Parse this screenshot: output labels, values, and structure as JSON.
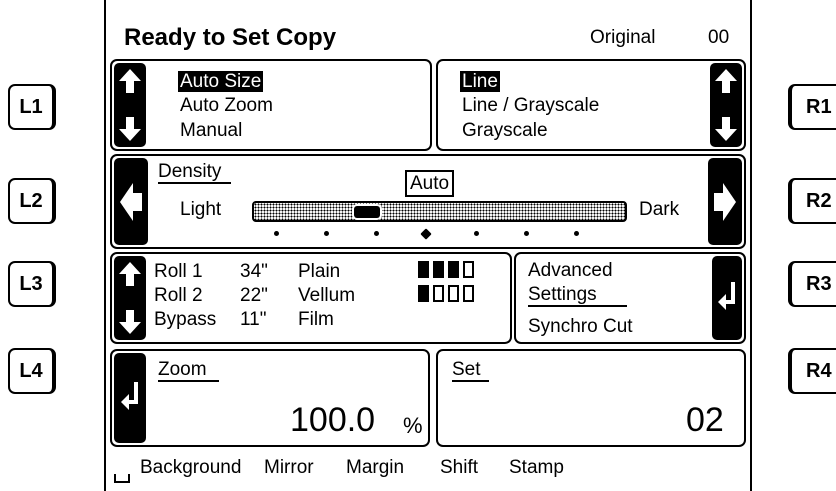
{
  "header": {
    "title": "Ready to Set Copy",
    "original_label": "Original",
    "original_count": "00"
  },
  "side_keys": {
    "left": [
      "L1",
      "L2",
      "L3",
      "L4"
    ],
    "right": [
      "R1",
      "R2",
      "R3",
      "R4"
    ]
  },
  "size_panel": {
    "options": [
      "Auto Size",
      "Auto Zoom",
      "Manual"
    ],
    "selected": "Auto Size"
  },
  "mode_panel": {
    "options": [
      "Line",
      "Line / Grayscale",
      "Grayscale"
    ],
    "selected": "Line"
  },
  "density": {
    "label": "Density",
    "auto_label": "Auto",
    "light_label": "Light",
    "dark_label": "Dark",
    "level": 0.35,
    "steps": 7,
    "center_step": 4
  },
  "media": {
    "rows": [
      {
        "name": "Roll 1",
        "size": "34\"",
        "type": "Plain",
        "fill": 3
      },
      {
        "name": "Roll 2",
        "size": "22\"",
        "type": "Vellum",
        "fill": 1
      },
      {
        "name": "Bypass",
        "size": "11\"",
        "type": "Film",
        "fill": null
      }
    ],
    "gauge_segments": 4
  },
  "advanced": {
    "line1": "Advanced",
    "line2": "Settings",
    "synchro": "Synchro Cut"
  },
  "zoom": {
    "label": "Zoom",
    "value": "100.0",
    "unit": "%"
  },
  "set": {
    "label": "Set",
    "value": "02"
  },
  "bottom_bar": {
    "items": [
      "Background",
      "Mirror",
      "Margin",
      "Shift",
      "Stamp"
    ]
  },
  "icons": {
    "up": "arrow-up-icon",
    "down": "arrow-down-icon",
    "left": "arrow-left-icon",
    "right": "arrow-right-icon",
    "enter": "enter-icon"
  }
}
